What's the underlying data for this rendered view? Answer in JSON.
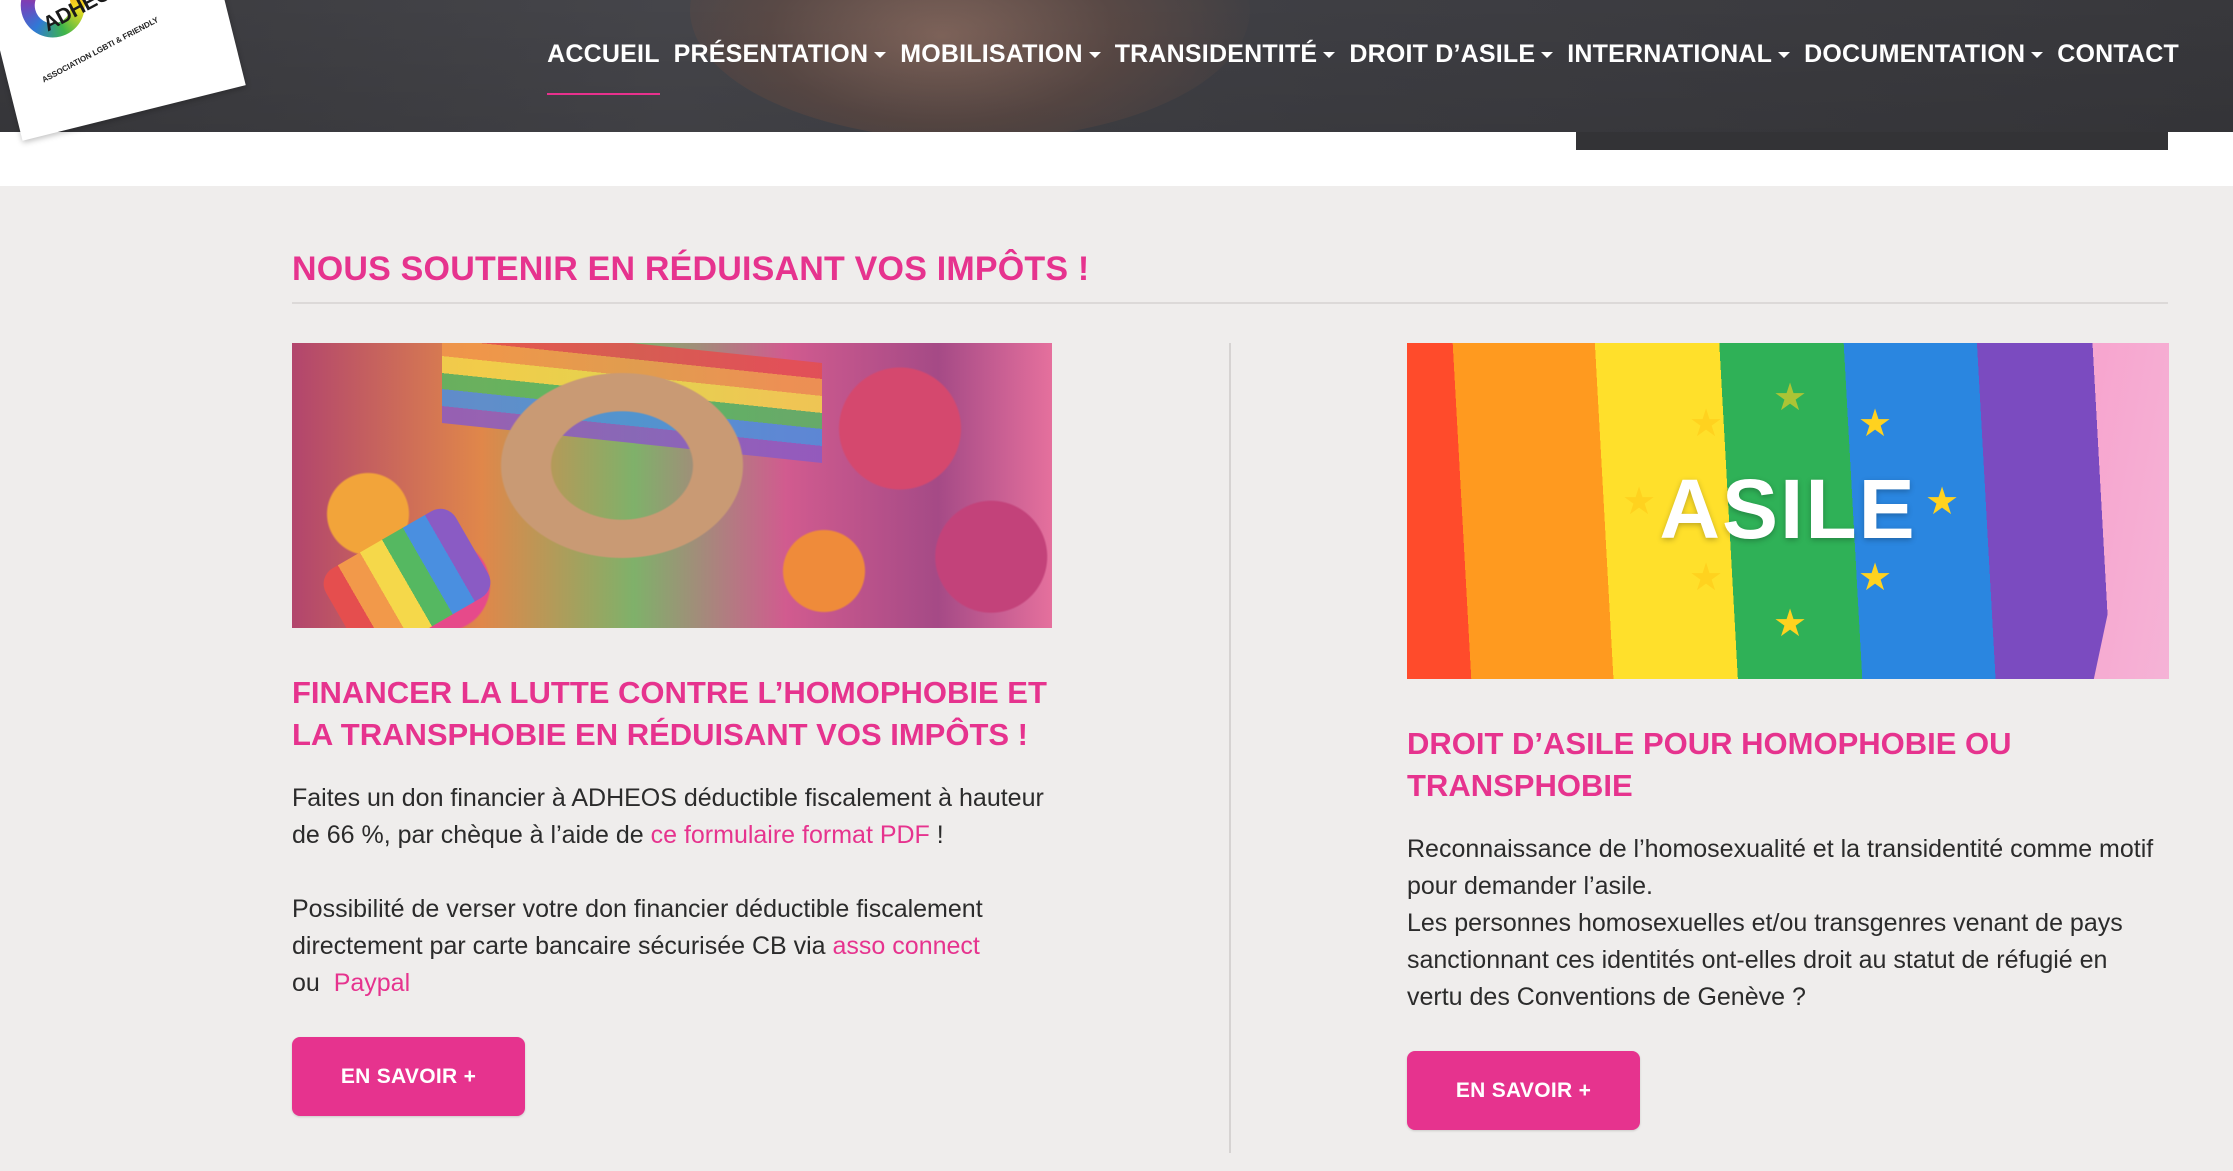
{
  "logo": {
    "name": "ADHEOS",
    "tagline": "ASSOCIATION LGBTI & FRIENDLY"
  },
  "nav": {
    "items": [
      {
        "label": "ACCUEIL",
        "dropdown": false,
        "active": true
      },
      {
        "label": "PRÉSENTATION",
        "dropdown": true
      },
      {
        "label": "MOBILISATION",
        "dropdown": true
      },
      {
        "label": "TRANSIDENTITÉ",
        "dropdown": true
      },
      {
        "label": "DROIT D’ASILE",
        "dropdown": true
      },
      {
        "label": "INTERNATIONAL",
        "dropdown": true
      },
      {
        "label": "DOCUMENTATION",
        "dropdown": true
      },
      {
        "label": "CONTACT",
        "dropdown": false
      }
    ]
  },
  "section": {
    "title": "NOUS SOUTENIR EN RÉDUISANT VOS IMPÔTS !"
  },
  "left_card": {
    "image_icon": "heart-hands-pride-image",
    "title": "FINANCER LA LUTTE CONTRE L’HOMOPHOBIE ET LA TRANSPHOBIE EN RÉDUISANT VOS IMPÔTS !",
    "p1_before": "Faites un don financier à ADHEOS déductible fiscalement à hauteur de 66 %, par chèque à l’aide de ",
    "p1_link": "ce formulaire format PDF",
    "p1_after": " !",
    "p2_before": "Possibilité de verser votre don financier déductible fiscalement directement  par carte bancaire sécurisée CB via ",
    "p2_link": "asso connect",
    "p3_before": "ou  ",
    "p3_link": "Paypal",
    "button": "EN SAVOIR +"
  },
  "right_card": {
    "image_icon": "asile-eu-rainbow-flag-image",
    "image_word": "ASILE",
    "title": "DROIT D’ASILE POUR HOMOPHOBIE OU TRANSPHOBIE",
    "p1": "Reconnaissance de l’homosexualité et la transidentité comme motif pour demander l’asile.",
    "p2": "Les personnes homosexuelles et/ou transgenres venant de pays sanctionnant ces identités ont-elles droit au statut de réfugié en vertu des Conventions de Genève ?",
    "button": "EN SAVOIR +"
  },
  "colors": {
    "accent": "#e6338e",
    "header_bg": "#3e3e43",
    "page_bg": "#efedec",
    "text": "#2b2b2b"
  }
}
